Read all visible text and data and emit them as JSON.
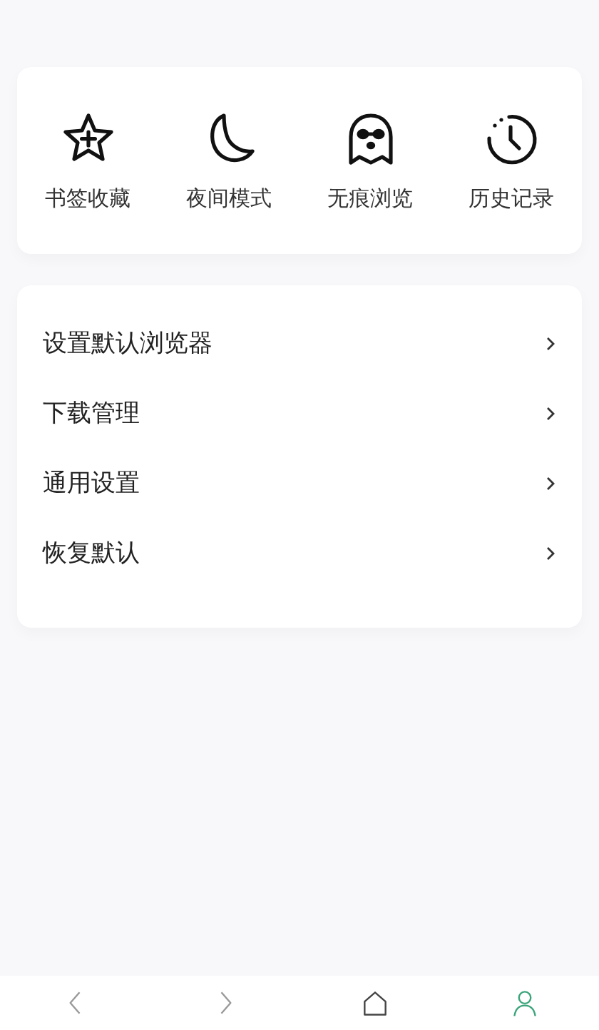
{
  "shortcuts": [
    {
      "kind": "star",
      "label": "书签收藏"
    },
    {
      "kind": "moon",
      "label": "夜间模式"
    },
    {
      "kind": "ghost",
      "label": "无痕浏览"
    },
    {
      "kind": "clock",
      "label": "历史记录"
    }
  ],
  "menu": [
    {
      "label": "设置默认浏览器"
    },
    {
      "label": "下载管理"
    },
    {
      "label": "通用设置"
    },
    {
      "label": "恢复默认"
    }
  ],
  "nav": [
    {
      "kind": "back",
      "selected": false
    },
    {
      "kind": "forward",
      "selected": false
    },
    {
      "kind": "home",
      "selected": false
    },
    {
      "kind": "profile",
      "selected": true
    }
  ]
}
